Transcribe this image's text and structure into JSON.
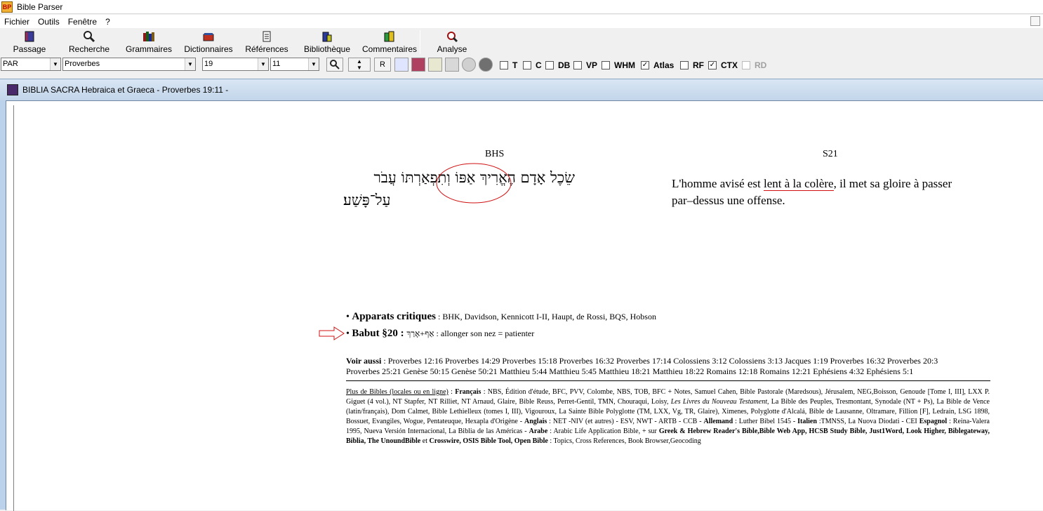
{
  "app": {
    "title": "Bible Parser",
    "icon_text": "BP"
  },
  "menu": [
    "Fichier",
    "Outils",
    "Fenêtre",
    "?"
  ],
  "toolbar": {
    "buttons": [
      {
        "label": "Passage",
        "icon": "book-icon"
      },
      {
        "label": "Recherche",
        "icon": "magnifier-icon"
      },
      {
        "label": "Grammaires",
        "icon": "grammar-books-icon"
      },
      {
        "label": "Dictionnaires",
        "icon": "dictionary-icon"
      },
      {
        "label": "Références",
        "icon": "references-icon"
      },
      {
        "label": "Bibliothèque",
        "icon": "library-icon"
      },
      {
        "label": "Commentaires",
        "icon": "commentary-icon"
      },
      {
        "label": "Analyse",
        "icon": "analysis-icon"
      }
    ]
  },
  "controls": {
    "version": "PAR",
    "book": "Proverbes",
    "chapter": "19",
    "verse": "11",
    "r_button": "R",
    "checkboxes": [
      {
        "label": "T",
        "checked": false,
        "disabled": false
      },
      {
        "label": "C",
        "checked": false,
        "disabled": false
      },
      {
        "label": "DB",
        "checked": false,
        "disabled": false
      },
      {
        "label": "VP",
        "checked": false,
        "disabled": false
      },
      {
        "label": "WHM",
        "checked": false,
        "disabled": false
      },
      {
        "label": "Atlas",
        "checked": true,
        "disabled": false
      },
      {
        "label": "RF",
        "checked": false,
        "disabled": false
      },
      {
        "label": "CTX",
        "checked": true,
        "disabled": false
      },
      {
        "label": "RD",
        "checked": false,
        "disabled": true
      }
    ]
  },
  "window": {
    "title": "BIBLIA SACRA Hebraica et Graeca - Proverbes 19:11 -"
  },
  "passage": {
    "left_header": "BHS",
    "right_header": "S21",
    "hebrew_line1": "שֵׂכֶל אָדָם הֶאֱרִיךְ אַפּוֹ וְתִפְאַרְתּוֹ עֲבֹר",
    "hebrew_line2": "עַל־פָּשַׁע׃",
    "french_a": "L'homme avisé est ",
    "french_highlight": "lent à la colère",
    "french_b": ", il met sa gloire à passer",
    "french_line2": "par–dessus une offense."
  },
  "notes": {
    "apparats_label": "Apparats critiques",
    "apparats_text": " : BHK, Davidson, Kennicott I-II, Haupt, de Rossi, BQS, Hobson",
    "babut_label": "Babut §20",
    "babut_sep": " : ",
    "babut_hebrew": "אַף+אָרַךְ",
    "babut_text": " : allonger son nez = patienter"
  },
  "voir": {
    "label": "Voir aussi",
    "line1": " : Proverbes 12:16 Proverbes 14:29 Proverbes 15:18 Proverbes 16:32 Proverbes 17:14 Colossiens 3:12 Colossiens 3:13 Jacques 1:19 Proverbes 16:32 Proverbes 20:3",
    "line2": "Proverbes 25:21 Genèse 50:15 Genèse 50:21 Matthieu 5:44 Matthieu 5:45 Matthieu 18:21 Matthieu 18:22 Romains 12:18 Romains 12:21 Ephésiens 4:32 Ephésiens 5:1"
  },
  "plus": {
    "link": "Plus de Bibles (locales ou en ligne)",
    "t1": " : ",
    "francais": "Français",
    "t2": " : NBS, Édition d'étude, BFC, PVV, Colombe, NBS, TOB, BFC + Notes, Samuel Cahen, Bible Pastorale (Maredsous), Jérusalem, NEG,Boisson, Genoude [Tome I, III], LXX P. Giguet (4 vol.), NT Stapfer, NT Rilliet, NT Arnaud, Glaire, Bible Reuss, Perret-Gentil, TMN, Chouraqui, Loisy, ",
    "livres": "Les Livres du Nouveau Testament",
    "t3": ", La Bible des Peuples, Tresmontant, Synodale (NT + Ps), La Bible de Vence (latin/français), Dom Calmet, Bible Lethielleux (tomes I, III), Vigouroux, La Sainte Bible Polyglotte (TM, LXX, Vg, TR, Glaire), Ximenes, Polyglotte d'Alcalá, Bible de Lausanne, Oltramare, Fillion [F], Ledrain, LSG 1898, Bossuet, Evangiles, Wogue, Pentateuque, Hexapla d'Origène - ",
    "anglais": "Anglais",
    "t4": " : NET -NIV (et autres) - ESV, NWT - ARTB - CCB - ",
    "allemand": "Allemand",
    "t5": " : Luther Bibel 1545 - ",
    "italien": "Italien",
    "t6": " :TMNSS, La Nuova Diodati - CEI ",
    "espagnol": "Espagnol",
    "t7": " : Reina-Valera 1995, Nueva Versión Internacional, La Biblia de las Américas - ",
    "arabe": "Arabe",
    "t8": " : Arabic Life Application Bible, + sur ",
    "bold1": "Greek & Hebrew Reader's Bible,Bible Web App, HCSB Study Bible, Just1Word, Look Higher, Biblegateway, Biblia, The UnoundBible",
    "t9": " et ",
    "bold2": "Crosswire, OSIS Bible Tool, Open Bible",
    "t10": " : Topics, Cross References, Book Browser,Geocoding"
  },
  "colors": {
    "highlight": "#d01010",
    "titlebar": "#ffffff",
    "mdi_title": "#c9dbee"
  }
}
